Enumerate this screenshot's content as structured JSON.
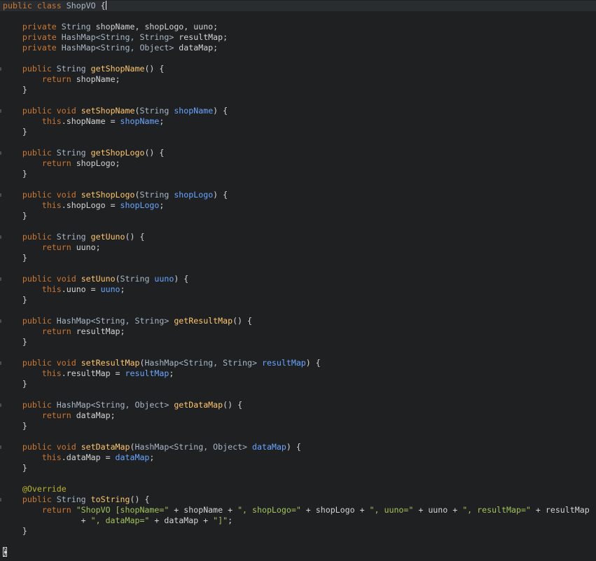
{
  "editor": {
    "language": "Java",
    "lines": [
      [
        {
          "t": "public class ",
          "c": "kw"
        },
        {
          "t": "ShopVO",
          "c": "ty"
        },
        {
          "t": " {",
          "c": "plain"
        }
      ],
      [],
      [
        {
          "t": "    private ",
          "c": "kw"
        },
        {
          "t": "String ",
          "c": "ty"
        },
        {
          "t": "shopName, shopLogo, uuno;",
          "c": "plain"
        }
      ],
      [
        {
          "t": "    private ",
          "c": "kw"
        },
        {
          "t": "HashMap<String, String> ",
          "c": "ty"
        },
        {
          "t": "resultMap;",
          "c": "plain"
        }
      ],
      [
        {
          "t": "    private ",
          "c": "kw"
        },
        {
          "t": "HashMap<String, Object> ",
          "c": "ty"
        },
        {
          "t": "dataMap;",
          "c": "plain"
        }
      ],
      [],
      [
        {
          "t": "    public ",
          "c": "kw"
        },
        {
          "t": "String ",
          "c": "ty"
        },
        {
          "t": "getShopName",
          "c": "fn"
        },
        {
          "t": "() {",
          "c": "plain"
        }
      ],
      [
        {
          "t": "        return ",
          "c": "kw"
        },
        {
          "t": "shopName;",
          "c": "plain"
        }
      ],
      [
        {
          "t": "    }",
          "c": "plain"
        }
      ],
      [],
      [
        {
          "t": "    public void ",
          "c": "kw"
        },
        {
          "t": "setShopName",
          "c": "fn"
        },
        {
          "t": "(",
          "c": "plain"
        },
        {
          "t": "String ",
          "c": "ty"
        },
        {
          "t": "shopName",
          "c": "param"
        },
        {
          "t": ") {",
          "c": "plain"
        }
      ],
      [
        {
          "t": "        this",
          "c": "kw"
        },
        {
          "t": ".shopName = ",
          "c": "plain"
        },
        {
          "t": "shopName",
          "c": "param"
        },
        {
          "t": ";",
          "c": "plain"
        }
      ],
      [
        {
          "t": "    }",
          "c": "plain"
        }
      ],
      [],
      [
        {
          "t": "    public ",
          "c": "kw"
        },
        {
          "t": "String ",
          "c": "ty"
        },
        {
          "t": "getShopLogo",
          "c": "fn"
        },
        {
          "t": "() {",
          "c": "plain"
        }
      ],
      [
        {
          "t": "        return ",
          "c": "kw"
        },
        {
          "t": "shopLogo;",
          "c": "plain"
        }
      ],
      [
        {
          "t": "    }",
          "c": "plain"
        }
      ],
      [],
      [
        {
          "t": "    public void ",
          "c": "kw"
        },
        {
          "t": "setShopLogo",
          "c": "fn"
        },
        {
          "t": "(",
          "c": "plain"
        },
        {
          "t": "String ",
          "c": "ty"
        },
        {
          "t": "shopLogo",
          "c": "param"
        },
        {
          "t": ") {",
          "c": "plain"
        }
      ],
      [
        {
          "t": "        this",
          "c": "kw"
        },
        {
          "t": ".shopLogo = ",
          "c": "plain"
        },
        {
          "t": "shopLogo",
          "c": "param"
        },
        {
          "t": ";",
          "c": "plain"
        }
      ],
      [
        {
          "t": "    }",
          "c": "plain"
        }
      ],
      [],
      [
        {
          "t": "    public ",
          "c": "kw"
        },
        {
          "t": "String ",
          "c": "ty"
        },
        {
          "t": "getUuno",
          "c": "fn"
        },
        {
          "t": "() {",
          "c": "plain"
        }
      ],
      [
        {
          "t": "        return ",
          "c": "kw"
        },
        {
          "t": "uuno;",
          "c": "plain"
        }
      ],
      [
        {
          "t": "    }",
          "c": "plain"
        }
      ],
      [],
      [
        {
          "t": "    public void ",
          "c": "kw"
        },
        {
          "t": "setUuno",
          "c": "fn"
        },
        {
          "t": "(",
          "c": "plain"
        },
        {
          "t": "String ",
          "c": "ty"
        },
        {
          "t": "uuno",
          "c": "param"
        },
        {
          "t": ") {",
          "c": "plain"
        }
      ],
      [
        {
          "t": "        this",
          "c": "kw"
        },
        {
          "t": ".uuno = ",
          "c": "plain"
        },
        {
          "t": "uuno",
          "c": "param"
        },
        {
          "t": ";",
          "c": "plain"
        }
      ],
      [
        {
          "t": "    }",
          "c": "plain"
        }
      ],
      [],
      [
        {
          "t": "    public ",
          "c": "kw"
        },
        {
          "t": "HashMap<String, String> ",
          "c": "ty"
        },
        {
          "t": "getResultMap",
          "c": "fn"
        },
        {
          "t": "() {",
          "c": "plain"
        }
      ],
      [
        {
          "t": "        return ",
          "c": "kw"
        },
        {
          "t": "resultMap;",
          "c": "plain"
        }
      ],
      [
        {
          "t": "    }",
          "c": "plain"
        }
      ],
      [],
      [
        {
          "t": "    public void ",
          "c": "kw"
        },
        {
          "t": "setResultMap",
          "c": "fn"
        },
        {
          "t": "(",
          "c": "plain"
        },
        {
          "t": "HashMap<String, String> ",
          "c": "ty"
        },
        {
          "t": "resultMap",
          "c": "param"
        },
        {
          "t": ") {",
          "c": "plain"
        }
      ],
      [
        {
          "t": "        this",
          "c": "kw"
        },
        {
          "t": ".resultMap = ",
          "c": "plain"
        },
        {
          "t": "resultMap",
          "c": "param"
        },
        {
          "t": ";",
          "c": "plain"
        }
      ],
      [
        {
          "t": "    }",
          "c": "plain"
        }
      ],
      [],
      [
        {
          "t": "    public ",
          "c": "kw"
        },
        {
          "t": "HashMap<String, Object> ",
          "c": "ty"
        },
        {
          "t": "getDataMap",
          "c": "fn"
        },
        {
          "t": "() {",
          "c": "plain"
        }
      ],
      [
        {
          "t": "        return ",
          "c": "kw"
        },
        {
          "t": "dataMap;",
          "c": "plain"
        }
      ],
      [
        {
          "t": "    }",
          "c": "plain"
        }
      ],
      [],
      [
        {
          "t": "    public void ",
          "c": "kw"
        },
        {
          "t": "setDataMap",
          "c": "fn"
        },
        {
          "t": "(",
          "c": "plain"
        },
        {
          "t": "HashMap<String, Object> ",
          "c": "ty"
        },
        {
          "t": "dataMap",
          "c": "param"
        },
        {
          "t": ") {",
          "c": "plain"
        }
      ],
      [
        {
          "t": "        this",
          "c": "kw"
        },
        {
          "t": ".dataMap = ",
          "c": "plain"
        },
        {
          "t": "dataMap",
          "c": "param"
        },
        {
          "t": ";",
          "c": "plain"
        }
      ],
      [
        {
          "t": "    }",
          "c": "plain"
        }
      ],
      [],
      [
        {
          "t": "    @Override",
          "c": "ann"
        }
      ],
      [
        {
          "t": "    public ",
          "c": "kw"
        },
        {
          "t": "String ",
          "c": "ty"
        },
        {
          "t": "toString",
          "c": "fn"
        },
        {
          "t": "() {",
          "c": "plain"
        }
      ],
      [
        {
          "t": "        return ",
          "c": "kw"
        },
        {
          "t": "\"ShopVO [shopName=\"",
          "c": "str"
        },
        {
          "t": " + shopName + ",
          "c": "plain"
        },
        {
          "t": "\", shopLogo=\"",
          "c": "str"
        },
        {
          "t": " + shopLogo + ",
          "c": "plain"
        },
        {
          "t": "\", uuno=\"",
          "c": "str"
        },
        {
          "t": " + uuno + ",
          "c": "plain"
        },
        {
          "t": "\", resultMap=\"",
          "c": "str"
        },
        {
          "t": " + resultMap",
          "c": "plain"
        }
      ],
      [
        {
          "t": "                + ",
          "c": "plain"
        },
        {
          "t": "\", dataMap=\"",
          "c": "str"
        },
        {
          "t": " + dataMap + ",
          "c": "plain"
        },
        {
          "t": "\"]\"",
          "c": "str"
        },
        {
          "t": ";",
          "c": "plain"
        }
      ],
      [
        {
          "t": "    }",
          "c": "plain"
        }
      ],
      [],
      [
        {
          "t": "}",
          "c": "plain"
        }
      ]
    ],
    "fold_markers_on_lines": [
      6,
      10,
      14,
      18,
      22,
      26,
      30,
      34,
      38,
      42,
      47
    ],
    "current_line": 0
  }
}
